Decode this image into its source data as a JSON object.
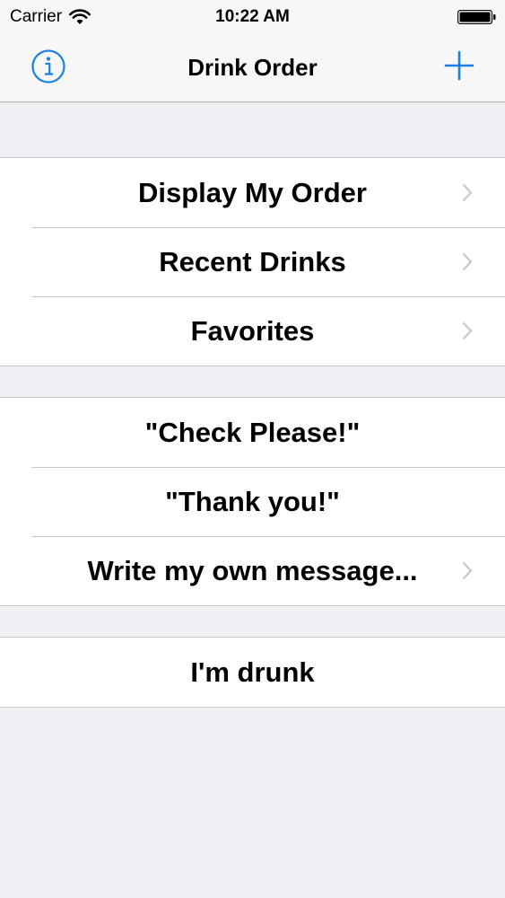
{
  "status_bar": {
    "carrier": "Carrier",
    "time": "10:22 AM",
    "icons": [
      "wifi-icon",
      "battery-icon"
    ]
  },
  "nav_bar": {
    "title": "Drink Order",
    "left_icon": "info-icon",
    "right_icon": "plus-icon",
    "accent_color": "#1a7fe4"
  },
  "sections": [
    {
      "rows": [
        {
          "label": "Display My Order",
          "chevron": true
        },
        {
          "label": "Recent Drinks",
          "chevron": true
        },
        {
          "label": "Favorites",
          "chevron": true
        }
      ]
    },
    {
      "rows": [
        {
          "label": "\"Check Please!\"",
          "chevron": false
        },
        {
          "label": "\"Thank you!\"",
          "chevron": false
        },
        {
          "label": "Write my own message...",
          "chevron": true
        }
      ]
    },
    {
      "rows": [
        {
          "label": "I'm drunk",
          "chevron": false
        }
      ]
    }
  ],
  "colors": {
    "background": "#efeff4",
    "separator": "#c8c7cc",
    "chevron": "#c7c7cc",
    "text": "#000000"
  }
}
